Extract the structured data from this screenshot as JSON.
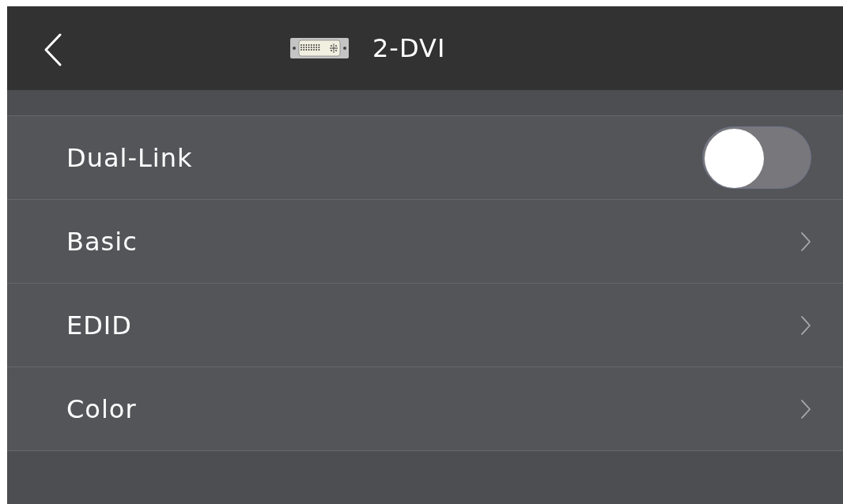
{
  "header": {
    "title": "2-DVI"
  },
  "rows": [
    {
      "kind": "toggle",
      "label": "Dual-Link",
      "on": false
    },
    {
      "kind": "link",
      "label": "Basic"
    },
    {
      "kind": "link",
      "label": "EDID"
    },
    {
      "kind": "link",
      "label": "Color"
    }
  ]
}
